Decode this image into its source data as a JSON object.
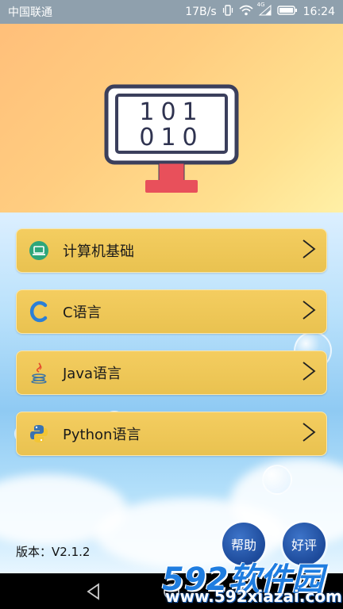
{
  "status_bar": {
    "carrier": "中国联通",
    "speed": "17B/s",
    "network": "4G",
    "time": "16:24"
  },
  "menu": [
    {
      "label": "计算机基础",
      "icon": "laptop-icon"
    },
    {
      "label": "C语言",
      "icon": "c-language-icon"
    },
    {
      "label": "Java语言",
      "icon": "java-icon"
    },
    {
      "label": "Python语言",
      "icon": "python-icon"
    }
  ],
  "banner": {
    "screen_line1": "101",
    "screen_line2": "010"
  },
  "version_text": "版本：V2.1.2",
  "buttons": {
    "help": "帮助",
    "rate": "好评"
  },
  "watermark": {
    "brand": "592软件园",
    "url": "www.592xiazai.com"
  },
  "colors": {
    "menu_bg": "#f0c956",
    "round_button": "#2a5db0",
    "monitor_frame": "#3b3f5c",
    "monitor_stand": "#e8505b"
  }
}
